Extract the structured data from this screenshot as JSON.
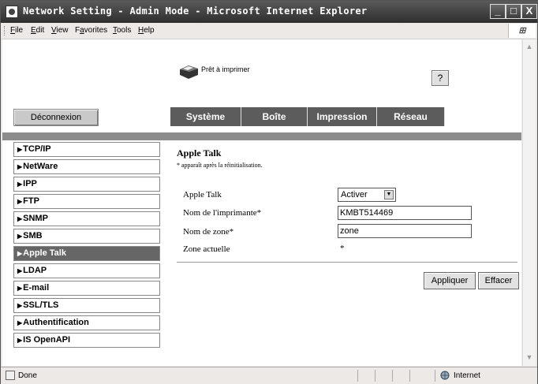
{
  "window": {
    "title": "Network Setting - Admin Mode - Microsoft Internet Explorer",
    "min_label": "_",
    "max_label": "□",
    "close_label": "X"
  },
  "menu": {
    "items": [
      {
        "label": "File",
        "accel": "F",
        "rest": "ile"
      },
      {
        "label": "Edit",
        "accel": "E",
        "rest": "dit"
      },
      {
        "label": "View",
        "accel": "V",
        "rest": "iew"
      },
      {
        "label": "Favorites",
        "accel": "a",
        "pre": "F",
        "rest": "vorites"
      },
      {
        "label": "Tools",
        "accel": "T",
        "rest": "ools"
      },
      {
        "label": "Help",
        "accel": "H",
        "rest": "elp"
      }
    ]
  },
  "header": {
    "printer_status": "Prêt à imprimer",
    "help_label": "?",
    "logout_label": "Déconnexion"
  },
  "tabs": [
    {
      "label": "Système"
    },
    {
      "label": "Boîte"
    },
    {
      "label": "Impression"
    },
    {
      "label": "Réseau"
    }
  ],
  "sidebar": {
    "items": [
      {
        "label": "TCP/IP",
        "active": false
      },
      {
        "label": "NetWare",
        "active": false
      },
      {
        "label": "IPP",
        "active": false
      },
      {
        "label": "FTP",
        "active": false
      },
      {
        "label": "SNMP",
        "active": false
      },
      {
        "label": "SMB",
        "active": false
      },
      {
        "label": "Apple Talk",
        "active": true
      },
      {
        "label": "LDAP",
        "active": false
      },
      {
        "label": "E-mail",
        "active": false
      },
      {
        "label": "SSL/TLS",
        "active": false
      },
      {
        "label": "Authentification",
        "active": false
      },
      {
        "label": "IS OpenAPI",
        "active": false
      }
    ]
  },
  "panel": {
    "title": "Apple Talk",
    "note": "* apparaît après la réinitialisation.",
    "fields": {
      "appletalk_label": "Apple Talk",
      "appletalk_value": "Activer",
      "printer_name_label": "Nom de l'imprimante*",
      "printer_name_value": "KMBT514469",
      "zone_name_label": "Nom de zone*",
      "zone_name_value": "zone",
      "current_zone_label": "Zone actuelle",
      "current_zone_value": "*"
    },
    "apply_label": "Appliquer",
    "clear_label": "Effacer"
  },
  "statusbar": {
    "text": "Done",
    "zone": "Internet"
  }
}
